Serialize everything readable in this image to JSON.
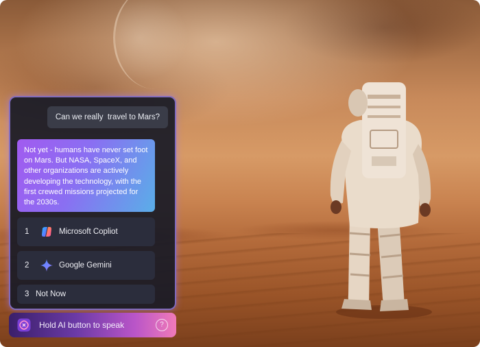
{
  "chat": {
    "user_message": "Can we really  travel to Mars?",
    "ai_response": "Not yet - humans have never set foot on Mars. But NASA, SpaceX, and other organizations are actively developing the technology, with the first crewed missions projected for the 2030s.",
    "options": [
      {
        "number": "1",
        "label": "Microsoft Copliot",
        "icon": "copilot-icon"
      },
      {
        "number": "2",
        "label": "Google Gemini",
        "icon": "gemini-icon"
      },
      {
        "number": "3",
        "label": "Not Now"
      }
    ]
  },
  "speak_bar": {
    "label": "Hold AI button to speak",
    "help_glyph": "?",
    "icon": "ai-voice-icon"
  },
  "colors": {
    "panel_border": "#aa8cff",
    "ai_bubble_start": "#a15bf0",
    "ai_bubble_end": "#5aaee8",
    "speak_start": "#3a1f6a",
    "speak_end": "#f07ab8"
  }
}
